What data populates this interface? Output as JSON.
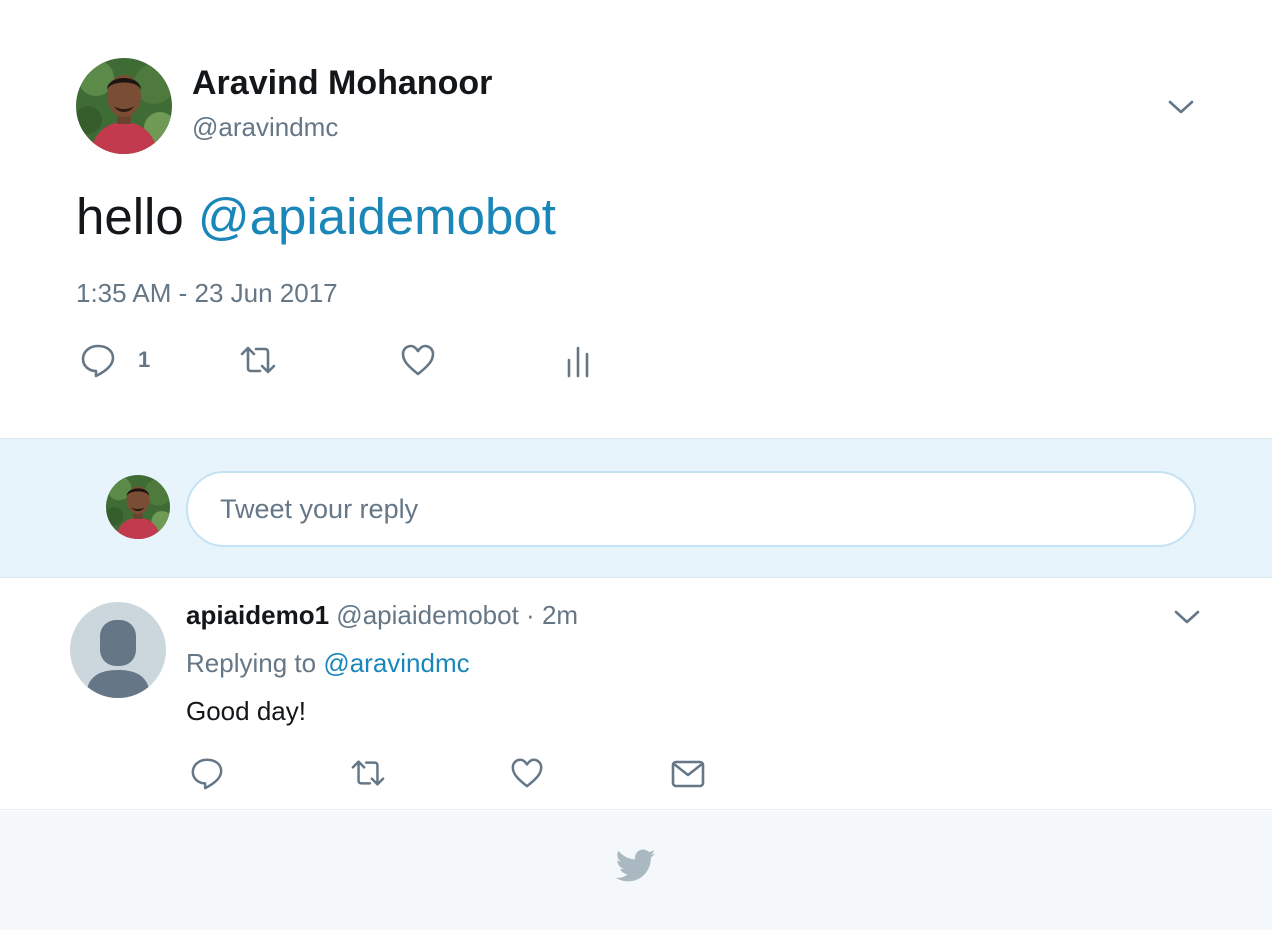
{
  "main_tweet": {
    "author_name": "Aravind Mohanoor",
    "author_handle": "@aravindmc",
    "text_prefix": "hello ",
    "text_mention": "@apiaidemobot",
    "timestamp": "1:35 AM - 23 Jun 2017",
    "reply_count": "1",
    "icons": [
      "reply-icon",
      "retweet-icon",
      "like-icon",
      "analytics-icon",
      "chevron-down-icon"
    ]
  },
  "composer": {
    "placeholder": "Tweet your reply"
  },
  "reply_tweet": {
    "author_name": "apiaidemo1",
    "author_handle": "@apiaidemobot",
    "separator": "·",
    "age": "2m",
    "replying_to_label": "Replying to ",
    "replying_to_handle": "@aravindmc",
    "text": "Good day!",
    "icons": [
      "reply-icon",
      "retweet-icon",
      "like-icon",
      "direct-message-icon",
      "chevron-down-icon"
    ]
  },
  "footer": {
    "icon": "twitter-bird-icon"
  },
  "colors": {
    "link": "#1b87b9",
    "secondary_text": "#657786",
    "composer_bg": "#e8f4fb",
    "footer_bg": "#f4f8fb",
    "icon_gray": "#657786",
    "bird_gray": "#aab8c2"
  }
}
